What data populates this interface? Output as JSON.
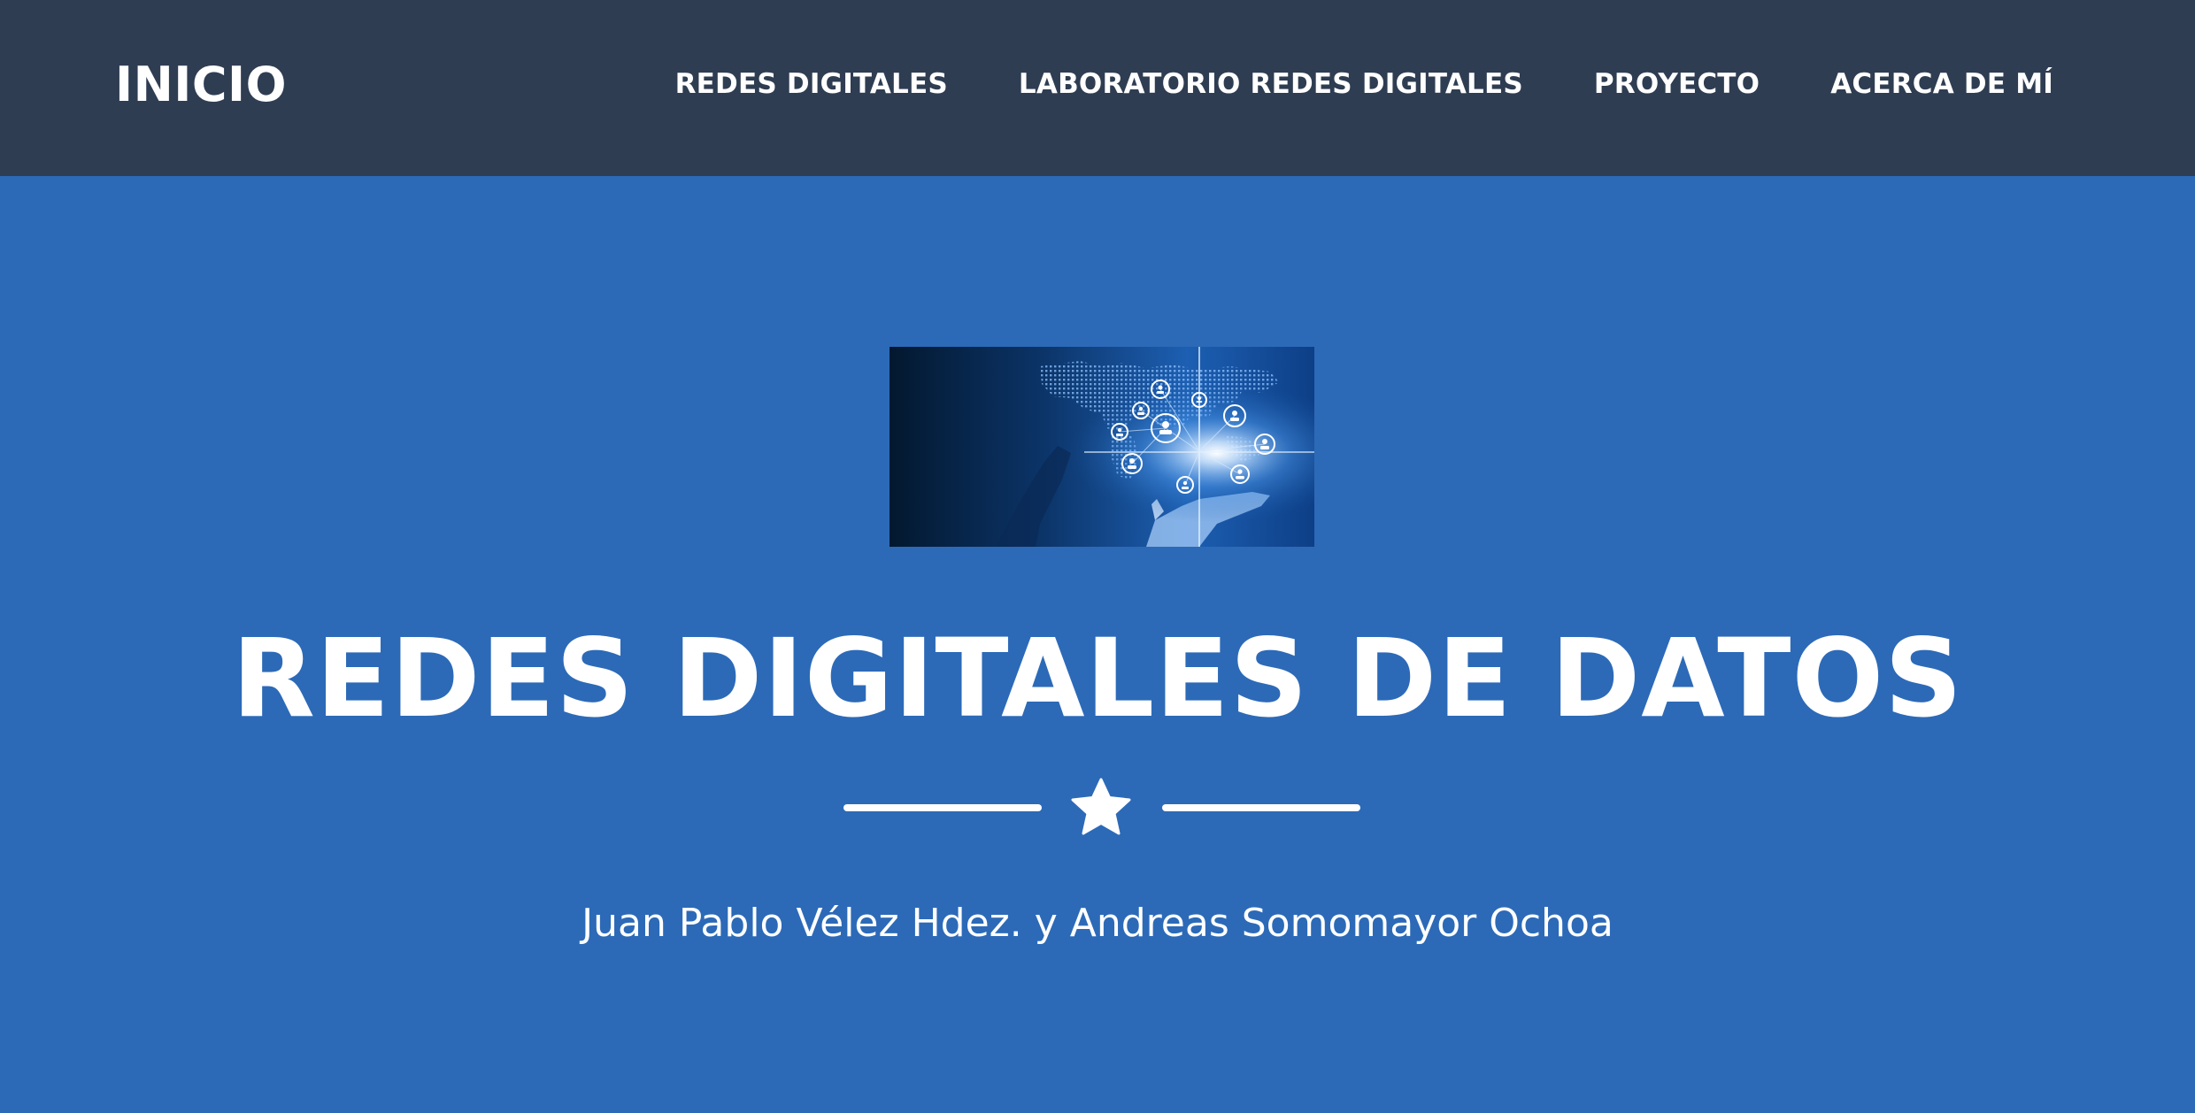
{
  "navbar": {
    "brand": "INICIO",
    "links": [
      {
        "label": "REDES DIGITALES"
      },
      {
        "label": "LABORATORIO REDES DIGITALES"
      },
      {
        "label": "PROYECTO"
      },
      {
        "label": "ACERCA DE MÍ"
      }
    ],
    "background": "#2f3d52"
  },
  "hero": {
    "image_icon": "network-globe-hand-image",
    "title": "REDES DIGITALES DE DATOS",
    "divider_icon": "star-icon",
    "subtitle": "Juan Pablo Vélez Hdez. y Andreas Somomayor Ochoa",
    "background": "#2c6ab8"
  }
}
